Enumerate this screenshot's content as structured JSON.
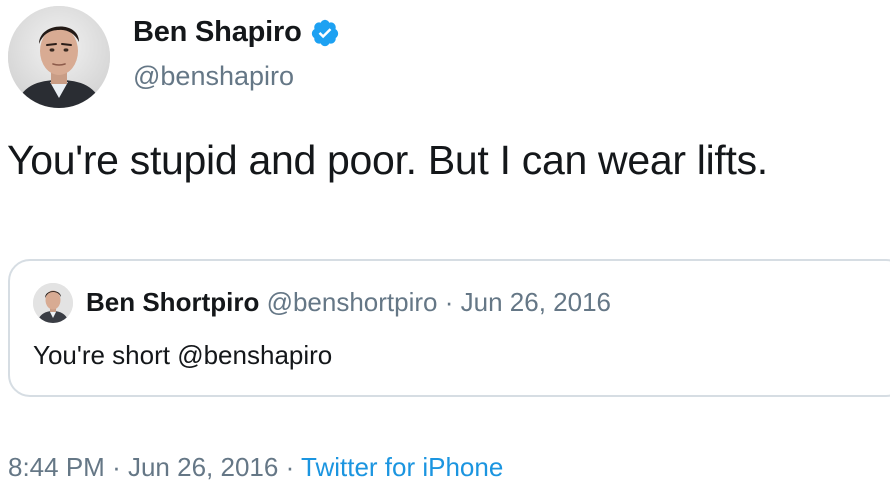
{
  "tweet": {
    "author": {
      "display_name": "Ben Shapiro",
      "handle": "@benshapiro",
      "verified": true,
      "avatar_icon": "profile-photo"
    },
    "text": "You're stupid and poor. But I can wear lifts.",
    "quoted_tweet": {
      "display_name": "Ben Shortpiro",
      "handle": "@benshortpiro",
      "separator": "·",
      "date": "Jun 26, 2016",
      "text": "You're short @benshapiro",
      "avatar_icon": "profile-photo"
    },
    "footer": {
      "time": "8:44 PM",
      "separator_1": "·",
      "date": "Jun 26, 2016",
      "separator_2": "·",
      "source": "Twitter for iPhone"
    }
  },
  "colors": {
    "text_primary": "#14171a",
    "text_secondary": "#657786",
    "link_blue": "#1b95e0",
    "verified_blue": "#1da1f2",
    "quote_border": "#d6dde3"
  }
}
